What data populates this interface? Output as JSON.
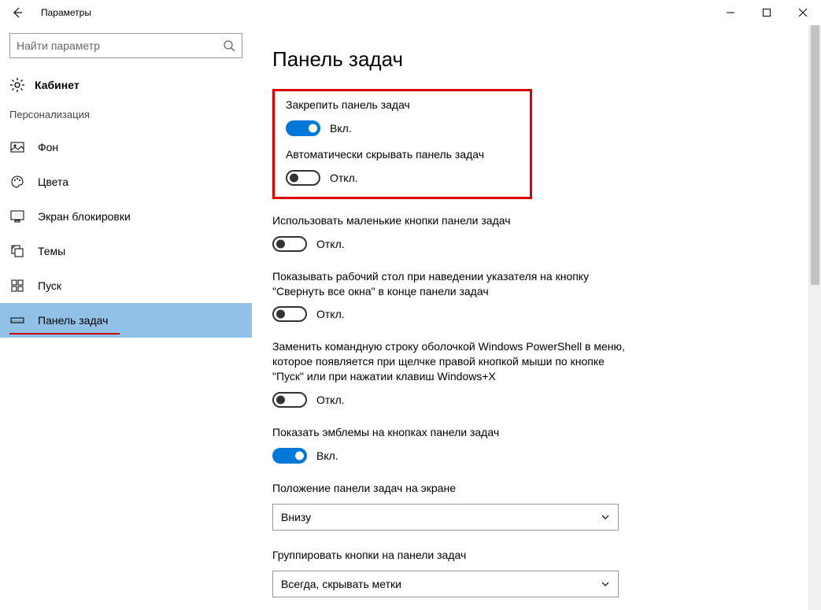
{
  "window": {
    "title": "Параметры"
  },
  "sidebar": {
    "search_placeholder": "Найти параметр",
    "home_label": "Кабинет",
    "section_title": "Персонализация",
    "items": [
      {
        "label": "Фон"
      },
      {
        "label": "Цвета"
      },
      {
        "label": "Экран блокировки"
      },
      {
        "label": "Темы"
      },
      {
        "label": "Пуск"
      },
      {
        "label": "Панель задач"
      }
    ]
  },
  "main": {
    "page_title": "Панель задач",
    "settings": {
      "lock_taskbar": {
        "label": "Закрепить панель задач",
        "state": "Вкл."
      },
      "auto_hide": {
        "label": "Автоматически скрывать панель задач",
        "state": "Откл."
      },
      "small_buttons": {
        "label": "Использовать маленькие кнопки панели задач",
        "state": "Откл."
      },
      "peek_desktop": {
        "label": "Показывать рабочий стол при наведении указателя на кнопку \"Свернуть все окна\" в конце панели задач",
        "state": "Откл."
      },
      "powershell": {
        "label": "Заменить командную строку оболочкой Windows PowerShell в меню, которое появляется при щелчке правой кнопкой мыши по кнопке \"Пуск\" или при нажатии клавиш Windows+X",
        "state": "Откл."
      },
      "badges": {
        "label": "Показать эмблемы на кнопках панели задач",
        "state": "Вкл."
      },
      "position": {
        "label": "Положение панели задач на экране",
        "value": "Внизу"
      },
      "combine": {
        "label": "Группировать кнопки на панели задач",
        "value": "Всегда, скрывать метки"
      }
    }
  }
}
